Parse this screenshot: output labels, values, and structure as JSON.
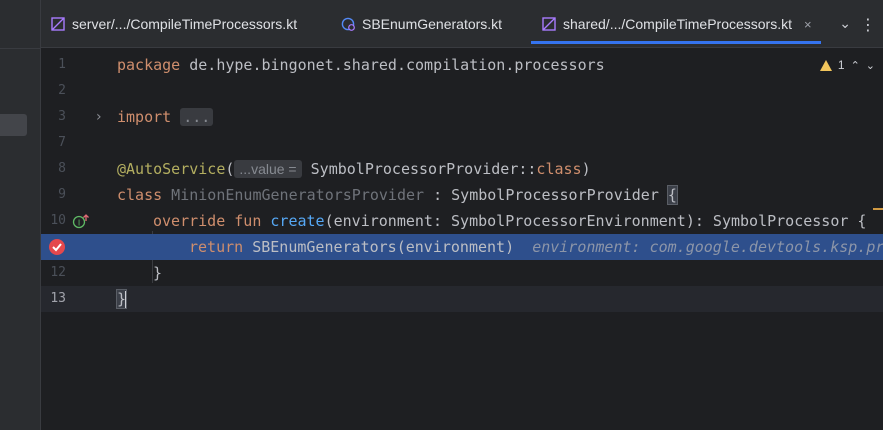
{
  "tabs": [
    {
      "label": "server/.../CompileTimeProcessors.kt",
      "active": false,
      "icon": "kotlin-file-icon"
    },
    {
      "label": "SBEnumGenerators.kt",
      "active": false,
      "icon": "kotlin-class-icon"
    },
    {
      "label": "shared/.../CompileTimeProcessors.kt",
      "active": true,
      "icon": "kotlin-file-icon",
      "close": "×"
    }
  ],
  "tab_overflow": "⌄",
  "tab_menu": "⋮",
  "inspection": {
    "warnings": "1"
  },
  "lines": [
    {
      "num": "1",
      "package_kw": "package",
      "package_name": " de.hype.bingonet.shared.compilation.processors"
    },
    {
      "num": "2"
    },
    {
      "num": "3",
      "import_kw": "import",
      "folded": "..."
    },
    {
      "num": "7"
    },
    {
      "num": "8",
      "annotation": "@AutoService",
      "open": "(",
      "param_hint": "...value =",
      "arg": " SymbolProcessorProvider::",
      "arg_kw": "class",
      "close": ")"
    },
    {
      "num": "9",
      "class_kw": "class",
      "class_name": " MinionEnumGeneratorsProvider",
      "rest": " : SymbolProcessorProvider ",
      "brace": "{"
    },
    {
      "num": "10",
      "override_kw": "override",
      "fun_kw": "fun",
      "fn_name": "create",
      "rest": "(environment: SymbolProcessorEnvironment): SymbolProcessor {"
    },
    {
      "num": "",
      "return_kw": "return",
      "rest": " SBEnumGenerators(environment)",
      "inlay": "environment: com.google.devtools.ksp.pr"
    },
    {
      "num": "12",
      "text": "}"
    },
    {
      "num": "13",
      "text": "}"
    }
  ]
}
